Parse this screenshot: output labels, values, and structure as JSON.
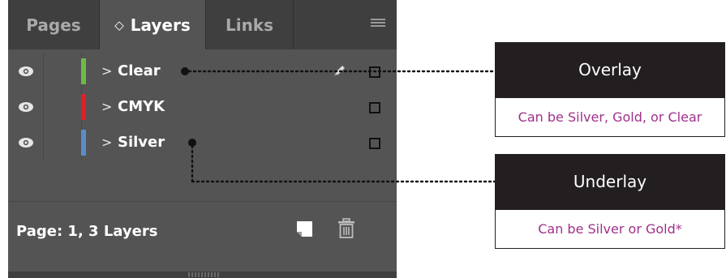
{
  "tabs": {
    "pages": "Pages",
    "layers": "Layers",
    "layers_arrows": "◇",
    "links": "Links"
  },
  "panel_menu_icon": "hamburger-menu-icon",
  "layers": [
    {
      "name": "Clear",
      "chevron": ">",
      "color": "#6dbb45",
      "visible": true,
      "has_pen": true
    },
    {
      "name": "CMYK",
      "chevron": ">",
      "color": "#e41e26",
      "visible": true,
      "has_pen": false
    },
    {
      "name": "Silver",
      "chevron": ">",
      "color": "#5b8cc8",
      "visible": true,
      "has_pen": false
    }
  ],
  "footer": {
    "status": "Page: 1, 3 Layers"
  },
  "callouts": {
    "overlay": {
      "title": "Overlay",
      "description": "Can be Silver, Gold, or Clear"
    },
    "underlay": {
      "title": "Underlay",
      "description": "Can be Silver or Gold*"
    }
  },
  "colors": {
    "panel_bg": "#545454",
    "tabbar_bg": "#3f3f3f",
    "callout_dark": "#231f20",
    "callout_text_accent": "#a0308a"
  }
}
